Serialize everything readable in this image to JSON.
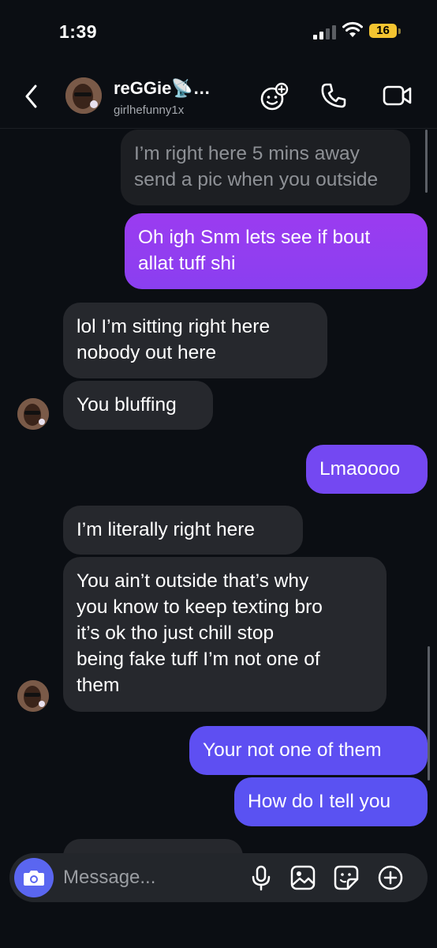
{
  "status_bar": {
    "time": "1:39",
    "battery": "16"
  },
  "header": {
    "name": "reGGie📡…",
    "username": "girlhefunny1x"
  },
  "messages": [
    {
      "text": "I’m right here 5 mins away\nsend a pic when you outside"
    },
    {
      "text": "Oh igh Snm lets see if bout\nallat tuff shi"
    },
    {
      "text": "lol I’m sitting right here\nnobody out here"
    },
    {
      "text": "You bluffing"
    },
    {
      "text": "Lmaoooo"
    },
    {
      "text": "I’m literally right here"
    },
    {
      "text": "You ain’t outside that’s why\nyou know to keep texting bro\nit’s ok tho just chill stop\nbeing fake tuff I’m not one of\nthem"
    },
    {
      "text": "Your not one of them"
    },
    {
      "text": "How do I tell you"
    }
  ],
  "composer": {
    "placeholder": "Message..."
  },
  "colors": {
    "incoming": "#26282d",
    "outgoing_top": "#9b3cf0",
    "outgoing_bottom": "#5a52f2",
    "camera": "#5a66f0"
  }
}
